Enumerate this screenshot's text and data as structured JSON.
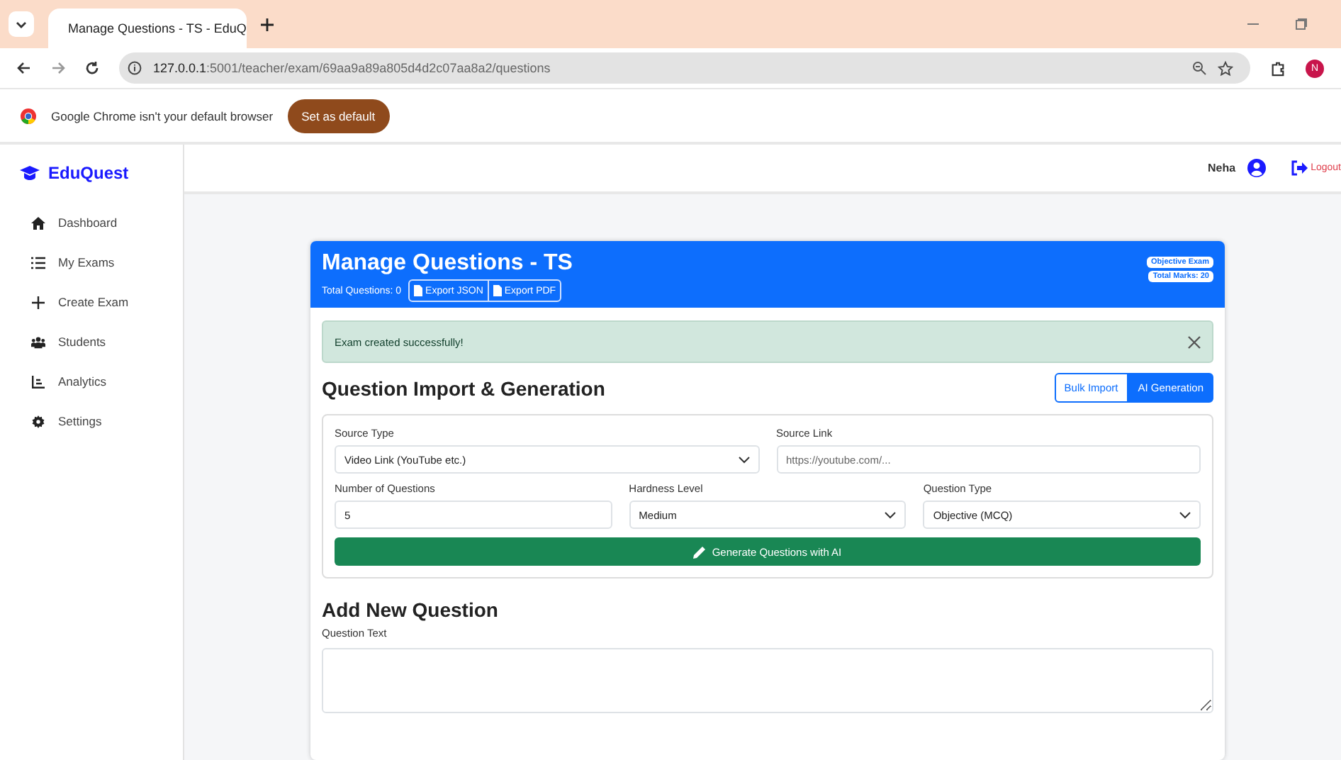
{
  "browser": {
    "tab_title": "Manage Questions - TS - EduQ",
    "url_host": "127.0.0.1",
    "url_path": ":5001/teacher/exam/69aa9a89a805d4d2c07aa8a2/questions",
    "profile_initial": "N",
    "infobar_text": "Google Chrome isn't your default browser",
    "infobar_button": "Set as default"
  },
  "sidebar": {
    "brand": "EduQuest",
    "items": [
      {
        "label": "Dashboard",
        "kind": "home"
      },
      {
        "label": "My Exams",
        "kind": "list"
      },
      {
        "label": "Create Exam",
        "kind": "create"
      },
      {
        "label": "Students",
        "kind": "people"
      },
      {
        "label": "Analytics",
        "kind": "analytics"
      },
      {
        "label": "Settings",
        "kind": "settings"
      }
    ]
  },
  "header": {
    "user": "Neha",
    "logout": "Logout"
  },
  "card": {
    "title": "Manage Questions - TS",
    "total": "Total Questions: 0",
    "exports": [
      "Export JSON",
      "Export PDF"
    ],
    "badges": [
      "Objective Exam",
      "Total Marks: 20"
    ],
    "alert": "Exam created successfully!",
    "import_title": "Question Import & Generation",
    "tabs": [
      {
        "label": "Bulk Import",
        "selected": false
      },
      {
        "label": "AI Generation",
        "selected": true
      }
    ],
    "source_type": {
      "label": "Source Type",
      "value": "Video Link (YouTube etc.)"
    },
    "source_link": {
      "label": "Source Link",
      "placeholder": "https://youtube.com/..."
    },
    "num_questions": {
      "label": "Number of Questions",
      "value": "5"
    },
    "hardness": {
      "label": "Hardness Level",
      "value": "Medium"
    },
    "question_type": {
      "label": "Question Type",
      "value": "Objective (MCQ)"
    },
    "generate_button": "Generate Questions with AI",
    "add_title": "Add New Question",
    "question_text_label": "Question Text"
  }
}
